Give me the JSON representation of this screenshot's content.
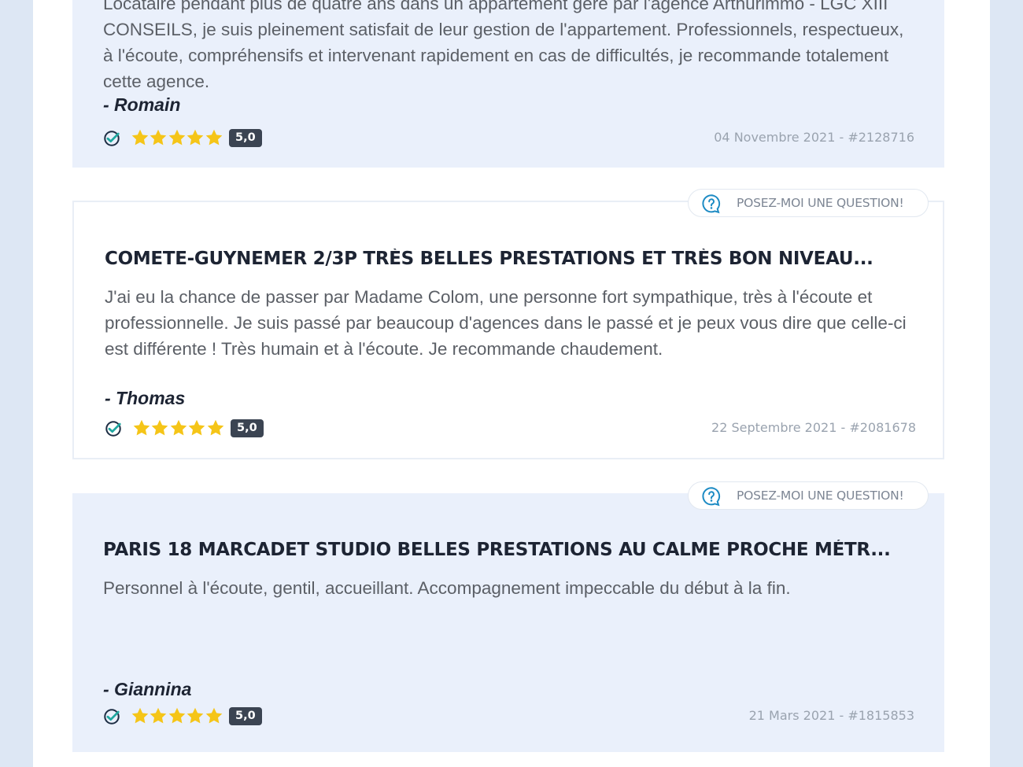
{
  "question_button_label": "POSEZ-MOI UNE QUESTION!",
  "colors": {
    "star": "#f5c518",
    "verified_check": "#1fa7a0",
    "question_icon": "#1d8bc4",
    "rating_badge": "#3b4452"
  },
  "icons": {
    "verified": "check-circle-icon",
    "star": "star-icon",
    "question": "question-bubble-icon"
  },
  "reviews": [
    {
      "title": "",
      "text": "Locataire pendant plus de quatre ans dans un appartement géré par l'agence Arthurimmo - LGC XIII CONSEILS, je suis pleinement satisfait de leur gestion de l'appartement. Professionnels, respectueux, à l'écoute, compréhensifs et intervenant rapidement en cas de difficultés, je recommande totalement cette agence.",
      "author": "- Romain",
      "stars": 5,
      "rating": "5,0",
      "date": "04 Novembre 2021 - #2128716"
    },
    {
      "title": "COMETE-GUYNEMER 2/3P TRÈS BELLES PRESTATIONS ET TRÈS BON NIVEAU...",
      "text": "J'ai eu la chance de passer par Madame Colom, une personne fort sympathique, très à l'écoute et professionnelle. Je suis passé par beaucoup d'agences dans le passé et je peux vous dire que celle-ci est différente ! Très humain et à l'écoute. Je recommande chaudement.",
      "author": "- Thomas",
      "stars": 5,
      "rating": "5,0",
      "date": "22 Septembre 2021 - #2081678"
    },
    {
      "title": "PARIS 18 MARCADET STUDIO BELLES PRESTATIONS AU CALME PROCHE MÉTR...",
      "text": "Personnel à l'écoute, gentil, accueillant. Accompagnement impeccable du début à la fin.",
      "author": "- Giannina",
      "stars": 5,
      "rating": "5,0",
      "date": "21 Mars 2021 - #1815853"
    }
  ]
}
